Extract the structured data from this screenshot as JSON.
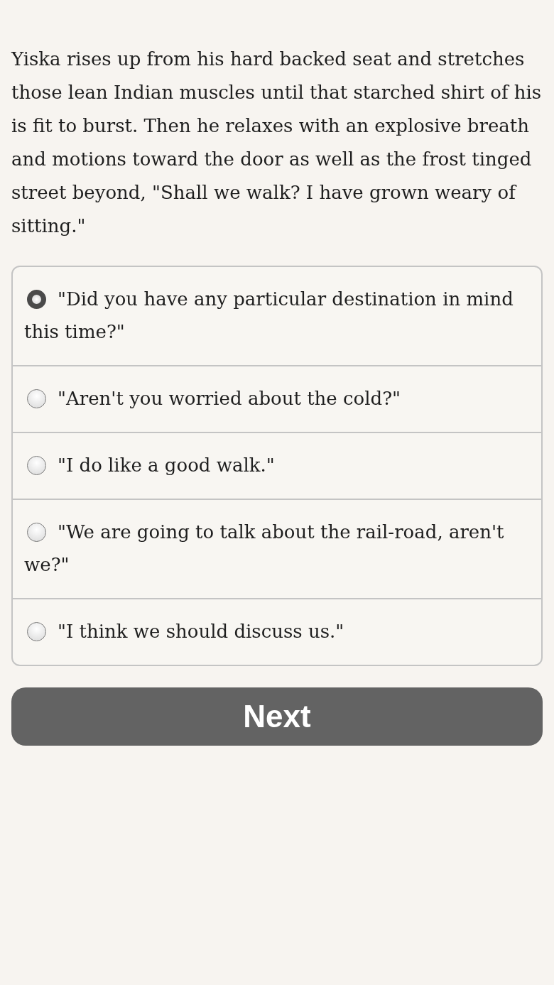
{
  "story_text": "Yiska rises up from his hard backed seat and stretches those lean Indian muscles until that starched shirt of his is fit to burst. Then he relaxes with an explosive breath and motions toward the door as well as the frost tinged street beyond, \"Shall we walk? I have grown weary of sitting.\"",
  "choices": [
    {
      "label": "\"Did you have any particular destination in mind this time?\"",
      "selected": true
    },
    {
      "label": "\"Aren't you worried about the cold?\"",
      "selected": false
    },
    {
      "label": "\"I do like a good walk.\"",
      "selected": false
    },
    {
      "label": "\"We are going to talk about the rail-road, aren't we?\"",
      "selected": false
    },
    {
      "label": "\"I think we should discuss us.\"",
      "selected": false
    }
  ],
  "next_button": "Next"
}
